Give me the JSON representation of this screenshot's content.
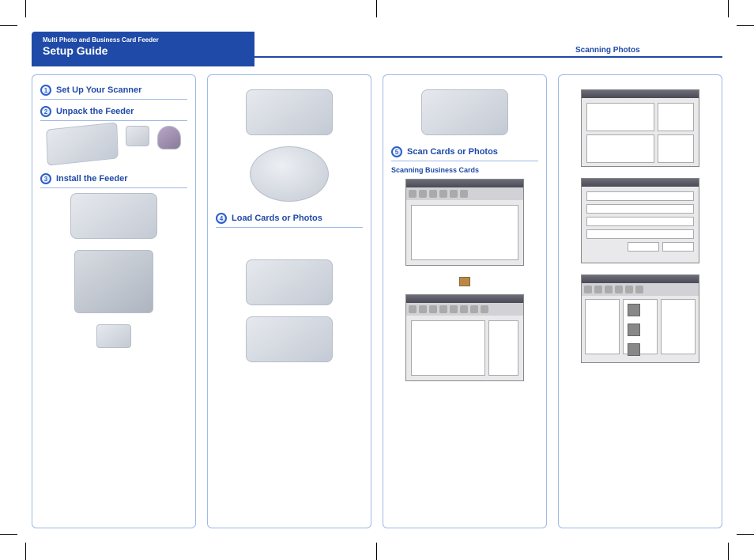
{
  "header": {
    "subtitle": "Multi Photo and Business Card Feeder",
    "title": "Setup Guide"
  },
  "column1": {
    "step1": {
      "num": "1",
      "title": "Set Up Your Scanner"
    },
    "step2": {
      "num": "2",
      "title": "Unpack the Feeder"
    },
    "step3": {
      "num": "3",
      "title": "Install the Feeder"
    }
  },
  "column2": {
    "step4": {
      "num": "4",
      "title": "Load Cards or Photos"
    }
  },
  "column3": {
    "step5": {
      "num": "5",
      "title": "Scan Cards or Photos"
    },
    "subheading": "Scanning Business Cards"
  },
  "column4": {
    "subheading": "Scanning Photos"
  }
}
